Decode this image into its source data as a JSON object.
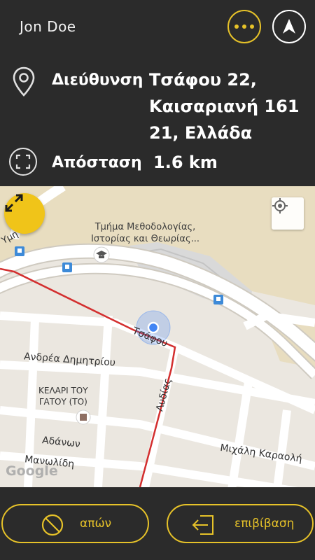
{
  "header": {
    "user_name": "Jon Doe",
    "more_icon": "more-dots-icon",
    "navigate_icon": "navigation-arrow-icon",
    "accent_color": "#e6c229"
  },
  "trip": {
    "address_icon": "location-pin-icon",
    "address_label": "Διεύθυνση",
    "address_value": "Τσάφου 22, Καισαριανή 161 21, Ελλάδα",
    "distance_icon": "distance-frame-icon",
    "distance_label": "Απόσταση",
    "distance_value": "1.6 km"
  },
  "map": {
    "poi_line1": "Τμήμα Μεθοδολογίας,",
    "poi_line2": "Ιστορίας και Θεωρίας...",
    "streets": {
      "tsafou": "Τσάφου",
      "andrea": "Ανδρέα Δημητρίου",
      "lydias": "Λυδίας",
      "adanon": "Αδάνων",
      "manolidi": "Μανωλίδη",
      "michali": "Μιχάλη Καραολή",
      "ymi": "Υμη"
    },
    "place_line1": "ΚΕΛΑΡΙ ΤΟΥ",
    "place_line2": "ΓΑΤΟΥ (ΤΟ)",
    "attribution": "Google",
    "route_color": "#d32f2f",
    "location_color": "#4285f4"
  },
  "footer": {
    "cancel_label": "απών",
    "board_label": "επιβίβαση",
    "cancel_icon": "no-entry-icon",
    "board_icon": "enter-arrow-icon"
  }
}
